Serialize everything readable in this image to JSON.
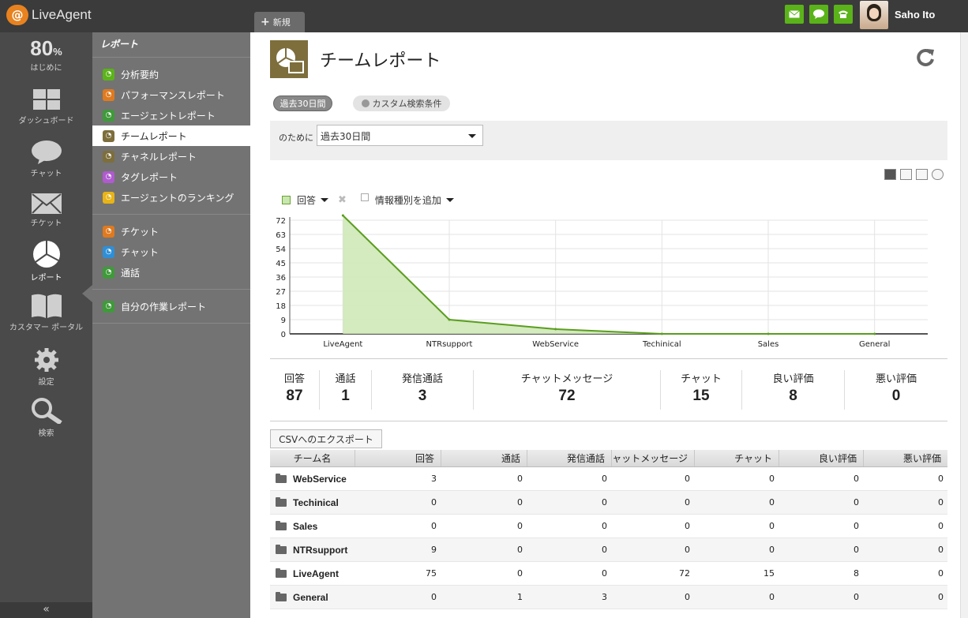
{
  "app": {
    "logo_text": "LiveAgent",
    "logo_mark": "@"
  },
  "topbar": {
    "new_tab": "新規",
    "user_name": "Saho Ito",
    "buttons": [
      "mail-icon",
      "chat-icon",
      "phone-icon"
    ]
  },
  "leftnav": {
    "progress_value": "80",
    "progress_unit": "%",
    "progress_label": "はじめに",
    "items": [
      {
        "label": "ダッシュボード",
        "icon": "dashboard-icon"
      },
      {
        "label": "チャット",
        "icon": "chat-bubble-icon"
      },
      {
        "label": "チケット",
        "icon": "envelope-icon"
      },
      {
        "label": "レポート",
        "icon": "pie-chart-icon"
      },
      {
        "label": "カスタマー ポータル",
        "icon": "book-icon"
      },
      {
        "label": "設定",
        "icon": "gear-icon"
      },
      {
        "label": "検索",
        "icon": "search-icon"
      }
    ],
    "collapse": "«"
  },
  "subnav": {
    "title": "レポート",
    "group1": [
      {
        "label": "分析要約",
        "color": "#5bb31a"
      },
      {
        "label": "パフォーマンスレポート",
        "color": "#e07a1f"
      },
      {
        "label": "エージェントレポート",
        "color": "#3f9a3a"
      },
      {
        "label": "チームレポート",
        "color": "#7d6e3c"
      },
      {
        "label": "チャネルレポート",
        "color": "#7d6e3c"
      },
      {
        "label": "タグレポート",
        "color": "#b05ad0"
      },
      {
        "label": "エージェントのランキング",
        "color": "#e8b416"
      }
    ],
    "group2": [
      {
        "label": "チケット",
        "color": "#e07a1f"
      },
      {
        "label": "チャット",
        "color": "#2f8fd6"
      },
      {
        "label": "通話",
        "color": "#3f9a3a"
      }
    ],
    "group3": [
      {
        "label": "自分の作業レポート",
        "color": "#3f9a3a"
      }
    ]
  },
  "main": {
    "title": "チームレポート",
    "chip_period": "過去30日間",
    "chip_custom": "カスタム検索条件",
    "filter_label": "のために",
    "filter_value": "過去30日間",
    "legend_series": "回答",
    "legend_add": "情報種別を追加"
  },
  "chart_data": {
    "type": "area",
    "categories": [
      "LiveAgent",
      "NTRsupport",
      "WebService",
      "Techinical",
      "Sales",
      "General"
    ],
    "series": [
      {
        "name": "回答",
        "values": [
          75,
          9,
          3,
          0,
          0,
          0
        ]
      }
    ],
    "yticks": [
      0,
      9,
      18,
      27,
      36,
      45,
      54,
      63,
      72
    ],
    "ylim": [
      0,
      72
    ],
    "grid": true,
    "colors": {
      "line": "#5a9e1e",
      "fill": "#cfe8b8"
    }
  },
  "stats": [
    {
      "label": "回答",
      "value": "87"
    },
    {
      "label": "通話",
      "value": "1"
    },
    {
      "label": "発信通話",
      "value": "3"
    },
    {
      "label": "チャットメッセージ",
      "value": "72"
    },
    {
      "label": "チャット",
      "value": "15"
    },
    {
      "label": "良い評価",
      "value": "8"
    },
    {
      "label": "悪い評価",
      "value": "0"
    }
  ],
  "table": {
    "export_label": "CSVへのエクスポート",
    "headers": [
      "チーム名",
      "回答",
      "通話",
      "発信通話",
      "ャットメッセージ",
      "チャット",
      "良い評価",
      "悪い評価"
    ],
    "rows": [
      [
        "WebService",
        "3",
        "0",
        "0",
        "0",
        "0",
        "0",
        "0"
      ],
      [
        "Techinical",
        "0",
        "0",
        "0",
        "0",
        "0",
        "0",
        "0"
      ],
      [
        "Sales",
        "0",
        "0",
        "0",
        "0",
        "0",
        "0",
        "0"
      ],
      [
        "NTRsupport",
        "9",
        "0",
        "0",
        "0",
        "0",
        "0",
        "0"
      ],
      [
        "LiveAgent",
        "75",
        "0",
        "0",
        "72",
        "15",
        "8",
        "0"
      ],
      [
        "General",
        "0",
        "1",
        "3",
        "0",
        "0",
        "0",
        "0"
      ]
    ]
  }
}
